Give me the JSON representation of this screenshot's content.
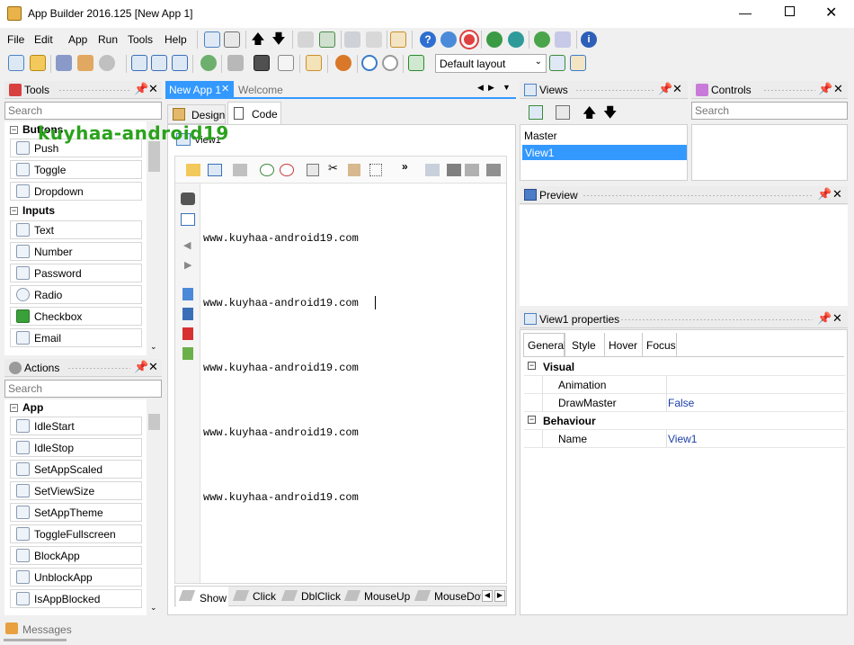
{
  "window": {
    "title": "App Builder 2016.125 [New App 1]"
  },
  "menu": [
    "File",
    "Edit",
    "App",
    "Run",
    "Tools",
    "Help"
  ],
  "layout_select": {
    "value": "Default layout"
  },
  "tools_panel": {
    "title": "Tools",
    "search_placeholder": "Search",
    "groups": [
      {
        "name": "Buttons",
        "items": [
          "Push",
          "Toggle",
          "Dropdown"
        ]
      },
      {
        "name": "Inputs",
        "items": [
          "Text",
          "Number",
          "Password",
          "Radio",
          "Checkbox",
          "Email"
        ]
      }
    ]
  },
  "actions_panel": {
    "title": "Actions",
    "search_placeholder": "Search",
    "group": "App",
    "items": [
      "IdleStart",
      "IdleStop",
      "SetAppScaled",
      "SetViewSize",
      "SetAppTheme",
      "ToggleFullscreen",
      "BlockApp",
      "UnblockApp",
      "IsAppBlocked"
    ]
  },
  "doc_tabs": {
    "active": "New App 1",
    "inactive": "Welcome"
  },
  "editor_tabs": {
    "design": "Design",
    "code": "Code"
  },
  "view_label": "View1",
  "watermark": "kuyhaa-android19",
  "code_lines": [
    "www.kuyhaa-android19.com",
    "www.kuyhaa-android19.com",
    "www.kuyhaa-android19.com",
    "www.kuyhaa-android19.com",
    "www.kuyhaa-android19.com"
  ],
  "event_tabs": [
    "Show",
    "Click",
    "DblClick",
    "MouseUp",
    "MouseDow"
  ],
  "views_panel": {
    "title": "Views",
    "items": [
      "Master",
      "View1"
    ],
    "selected": "View1"
  },
  "controls_panel": {
    "title": "Controls",
    "search_placeholder": "Search"
  },
  "preview_panel": {
    "title": "Preview"
  },
  "properties_panel": {
    "title": "View1 properties",
    "tabs": [
      "General",
      "Style",
      "Hover",
      "Focus"
    ],
    "sections": [
      {
        "name": "Visual",
        "rows": [
          {
            "key": "Animation",
            "value": ""
          },
          {
            "key": "DrawMaster",
            "value": "False"
          }
        ]
      },
      {
        "name": "Behaviour",
        "rows": [
          {
            "key": "Name",
            "value": "View1"
          }
        ]
      }
    ]
  },
  "messages_label": "Messages",
  "colors": {
    "accent": "#3399ff",
    "selected": "#3399ff",
    "value_text": "#1a3fa8",
    "watermark": "#2aa21c"
  }
}
